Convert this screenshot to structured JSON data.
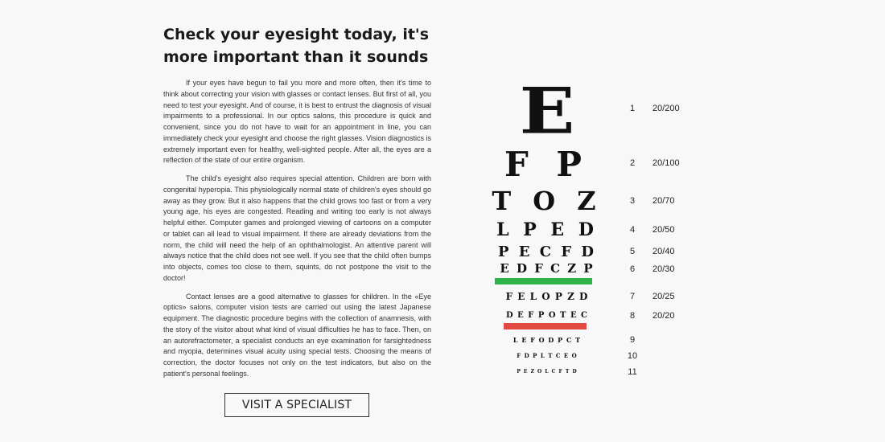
{
  "heading": "Check your eyesight today, it's more important than it sounds",
  "paragraphs": [
    "If your eyes have begun to fail you more and more often, then it's time to think about correcting your vision with glasses or contact lenses. But first of all, you need to test your eyesight. And of course, it is best to entrust the diagnosis of visual impairments to a professional. In our optics salons, this procedure is quick and convenient, since you do not have to wait for an appointment in line, you can immediately check your eyesight and choose the right glasses. Vision diagnostics is extremely important even for healthy, well-sighted people. After all, the eyes are a reflection of the state of our entire organism.",
    "The child's eyesight also requires special attention. Children are born with congenital hyperopia. This physiologically normal state of children's eyes should go away as they grow. But it also happens that the child grows too fast or from a very young age, his eyes are congested. Reading and writing too early is not always helpful either. Computer games and prolonged viewing of cartoons on a computer or tablet can all lead to visual impairment. If there are already deviations from the norm, the child will need the help of an ophthalmologist. An attentive parent will always notice that the child does not see well. If you see that the child often bumps into objects, comes too close to them, squints, do not postpone the visit to the doctor!",
    "Contact lenses are a good alternative to glasses for children. In the «Eye optics» salons, computer vision tests are carried out using the latest Japanese equipment. The diagnostic procedure begins with the collection of anamnesis, with the story of the visitor about what kind of visual difficulties he has to face. Then, on an autorefractometer, a specialist conducts an eye examination for farsightedness and myopia, determines visual acuity using special tests. Choosing the means of correction, the doctor focuses not only on the test indicators, but also on the patient's personal feelings."
  ],
  "cta_label": "VISIT A SPECIALIST",
  "eye_chart": {
    "rows": [
      {
        "letters": "E",
        "number": "1",
        "acuity": "20/200"
      },
      {
        "letters": "F P",
        "number": "2",
        "acuity": "20/100"
      },
      {
        "letters": "T O Z",
        "number": "3",
        "acuity": "20/70"
      },
      {
        "letters": "L P E D",
        "number": "4",
        "acuity": "20/50"
      },
      {
        "letters": "P E C F D",
        "number": "5",
        "acuity": "20/40"
      },
      {
        "letters": "E D F C Z P",
        "number": "6",
        "acuity": "20/30"
      },
      {
        "letters": "F E L O P Z D",
        "number": "7",
        "acuity": "20/25"
      },
      {
        "letters": "D E F P O T E C",
        "number": "8",
        "acuity": "20/20"
      },
      {
        "letters": "L E F O D P C T",
        "number": "9",
        "acuity": ""
      },
      {
        "letters": "F D P L T C E O",
        "number": "10",
        "acuity": ""
      },
      {
        "letters": "P E Z O L C F T D",
        "number": "11",
        "acuity": ""
      }
    ],
    "marker_colors": {
      "green": "#2db34a",
      "red": "#e04a42"
    }
  }
}
